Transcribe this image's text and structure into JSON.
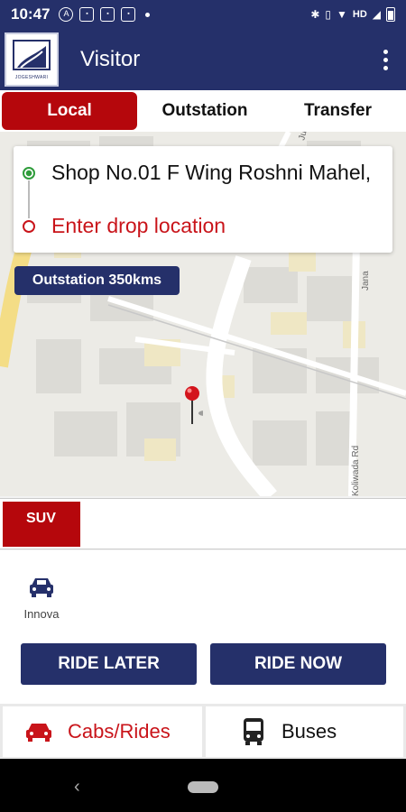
{
  "status_bar": {
    "time": "10:47",
    "icons": [
      "a-circle-icon",
      "notification-icon",
      "photo-icon",
      "notification-icon",
      "dot-icon"
    ],
    "network_label": "HD"
  },
  "app_bar": {
    "title": "Visitor",
    "logo_text": "JOGESHWARI"
  },
  "tabs": [
    {
      "label": "Local",
      "active": true
    },
    {
      "label": "Outstation",
      "active": false
    },
    {
      "label": "Transfer",
      "active": false
    }
  ],
  "locations": {
    "pickup": "Shop No.01 F Wing Roshni Mahel,",
    "drop_placeholder": "Enter drop location"
  },
  "badge": {
    "label": "Outstation 350kms"
  },
  "map_labels": {
    "road_1": "Jana",
    "road_2": "Koliwada Rd",
    "road_3": "Jub"
  },
  "category": {
    "label": "SUV"
  },
  "vehicles": [
    {
      "name": "Innova",
      "icon": "car-front-icon"
    }
  ],
  "actions": {
    "ride_later": "RIDE LATER",
    "ride_now": "RIDE NOW"
  },
  "bottom_nav": {
    "cabs": {
      "label": "Cabs/Rides",
      "icon": "car-icon",
      "color": "#c9141a"
    },
    "buses": {
      "label": "Buses",
      "icon": "bus-icon",
      "color": "#111111"
    }
  },
  "colors": {
    "primary": "#25306a",
    "accent": "#b5070c"
  }
}
